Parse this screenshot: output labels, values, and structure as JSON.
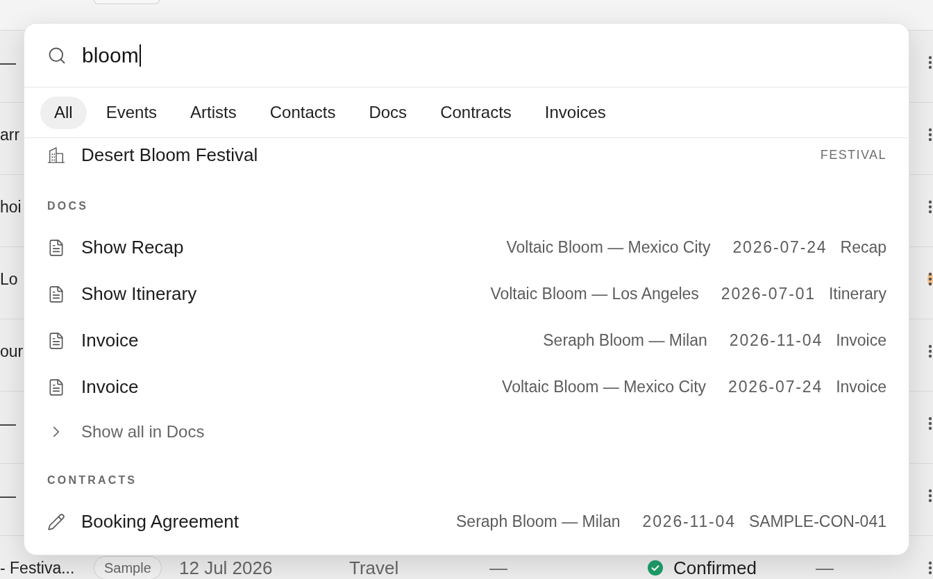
{
  "background_table": {
    "rows": [
      {
        "title": "—",
        "highlighted": false
      },
      {
        "title": "arr",
        "highlighted": false
      },
      {
        "title": "hoi",
        "highlighted": false
      },
      {
        "title": "Lo",
        "highlighted": true
      },
      {
        "title": "our",
        "highlighted": false
      },
      {
        "title": "—",
        "highlighted": false
      },
      {
        "title": "—",
        "highlighted": false
      },
      {
        "title": "- Festiva...",
        "tag": "Sample",
        "date": "12 Jul 2026",
        "category": "Travel",
        "column_5": "—",
        "status": "Confirmed",
        "column_7": "—",
        "highlighted": false
      }
    ]
  },
  "command_palette": {
    "search": {
      "value": "bloom"
    },
    "tabs": [
      {
        "label": "All",
        "selected": true
      },
      {
        "label": "Events",
        "selected": false
      },
      {
        "label": "Artists",
        "selected": false
      },
      {
        "label": "Contacts",
        "selected": false
      },
      {
        "label": "Docs",
        "selected": false
      },
      {
        "label": "Contracts",
        "selected": false
      },
      {
        "label": "Invoices",
        "selected": false
      }
    ],
    "sections": [
      {
        "items": [
          {
            "kind": "event",
            "title": "Desert Bloom Festival",
            "type": "FESTIVAL"
          }
        ]
      },
      {
        "heading": "DOCS",
        "items": [
          {
            "kind": "doc",
            "title": "Show Recap",
            "context": "Voltaic Bloom — Mexico City",
            "date": "2026-07-24",
            "type": "Recap"
          },
          {
            "kind": "doc",
            "title": "Show Itinerary",
            "context": "Voltaic Bloom — Los Angeles",
            "date": "2026-07-01",
            "type": "Itinerary"
          },
          {
            "kind": "doc",
            "title": "Invoice",
            "context": "Seraph Bloom — Milan",
            "date": "2026-11-04",
            "type": "Invoice"
          },
          {
            "kind": "doc",
            "title": "Invoice",
            "context": "Voltaic Bloom — Mexico City",
            "date": "2026-07-24",
            "type": "Invoice"
          }
        ],
        "show_all": "Show all in Docs"
      },
      {
        "heading": "CONTRACTS",
        "items": [
          {
            "kind": "contract",
            "title": "Booking Agreement",
            "context": "Seraph Bloom — Milan",
            "date": "2026-11-04",
            "type": "SAMPLE-CON-041"
          }
        ]
      }
    ]
  }
}
